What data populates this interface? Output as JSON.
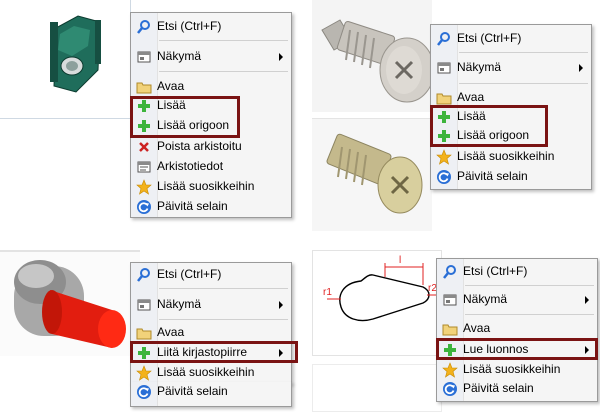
{
  "colors": {
    "highlight_border": "#7a1313",
    "menu_bg": "#f5f5f5",
    "gutter_bg": "#eef0f4",
    "add_icon": "#3cb43c",
    "delete_icon": "#cc2222",
    "refresh_icon": "#2a6fd6",
    "star_icon": "#f3b21c"
  },
  "menus": [
    {
      "items": [
        {
          "label": "Etsi (Ctrl+F)",
          "icon": "search-icon"
        },
        {
          "label": "Näkymä",
          "icon": "view-icon",
          "submenu": true
        },
        {
          "label": "Avaa",
          "icon": "folder-icon"
        },
        {
          "label": "Lisää",
          "icon": "add-icon"
        },
        {
          "label": "Lisää origoon",
          "icon": "add-icon"
        },
        {
          "label": "Poista arkistoitu",
          "icon": "delete-icon"
        },
        {
          "label": "Arkistotiedot",
          "icon": "properties-icon"
        },
        {
          "label": "Lisää suosikkeihin",
          "icon": "star-icon"
        },
        {
          "label": "Päivitä selain",
          "icon": "refresh-icon"
        }
      ]
    },
    {
      "items": [
        {
          "label": "Etsi (Ctrl+F)",
          "icon": "search-icon"
        },
        {
          "label": "Näkymä",
          "icon": "view-icon",
          "submenu": true
        },
        {
          "label": "Avaa",
          "icon": "folder-icon"
        },
        {
          "label": "Lisää",
          "icon": "add-icon"
        },
        {
          "label": "Lisää origoon",
          "icon": "add-icon"
        },
        {
          "label": "Lisää suosikkeihin",
          "icon": "star-icon"
        },
        {
          "label": "Päivitä selain",
          "icon": "refresh-icon"
        }
      ]
    },
    {
      "items": [
        {
          "label": "Etsi (Ctrl+F)",
          "icon": "search-icon"
        },
        {
          "label": "Näkymä",
          "icon": "view-icon",
          "submenu": true
        },
        {
          "label": "Avaa",
          "icon": "folder-icon"
        },
        {
          "label": "Liitä kirjastopiirre",
          "icon": "add-icon",
          "submenu": true
        },
        {
          "label": "Lisää suosikkeihin",
          "icon": "star-icon"
        },
        {
          "label": "Päivitä selain",
          "icon": "refresh-icon"
        }
      ]
    },
    {
      "items": [
        {
          "label": "Etsi (Ctrl+F)",
          "icon": "search-icon"
        },
        {
          "label": "Näkymä",
          "icon": "view-icon",
          "submenu": true
        },
        {
          "label": "Avaa",
          "icon": "folder-icon"
        },
        {
          "label": "Lue luonnos",
          "icon": "add-icon",
          "submenu": true
        },
        {
          "label": "Lisää suosikkeihin",
          "icon": "star-icon"
        },
        {
          "label": "Päivitä selain",
          "icon": "refresh-icon"
        }
      ]
    }
  ],
  "sketch": {
    "dim_top": "l",
    "dim_left": "r1",
    "dim_right": "r2"
  }
}
